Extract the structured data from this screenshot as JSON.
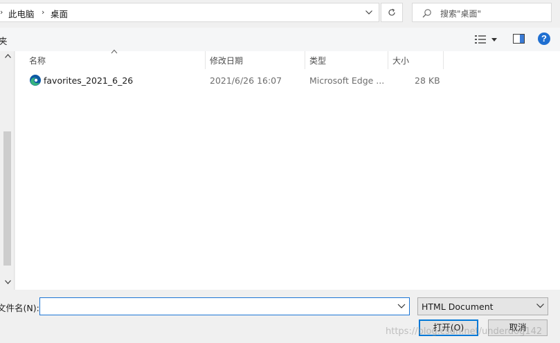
{
  "address_bar": {
    "breadcrumbs": [
      "此电脑",
      "桌面"
    ],
    "separator": "›"
  },
  "search": {
    "placeholder": "搜索\"桌面\""
  },
  "toolbar": {
    "left_label": "夹"
  },
  "columns": [
    {
      "key": "name",
      "label": "名称"
    },
    {
      "key": "modified",
      "label": "修改日期"
    },
    {
      "key": "type",
      "label": "类型"
    },
    {
      "key": "size",
      "label": "大小"
    }
  ],
  "files": [
    {
      "name": "favorites_2021_6_26",
      "modified": "2021/6/26 16:07",
      "type": "Microsoft Edge ...",
      "size": "28 KB",
      "icon": "edge-icon"
    }
  ],
  "bottom": {
    "filename_label": "文件名(N):",
    "filename_value": "",
    "filetype": "HTML Document",
    "open_label": "打开(O)",
    "cancel_label": "取消",
    "watermark": "https://blog.csdn.net/underdog142"
  },
  "colors": {
    "accent": "#0078d7",
    "help": "#1f6fd1",
    "edge_blue": "#0c59a4",
    "edge_green": "#36b37e"
  }
}
